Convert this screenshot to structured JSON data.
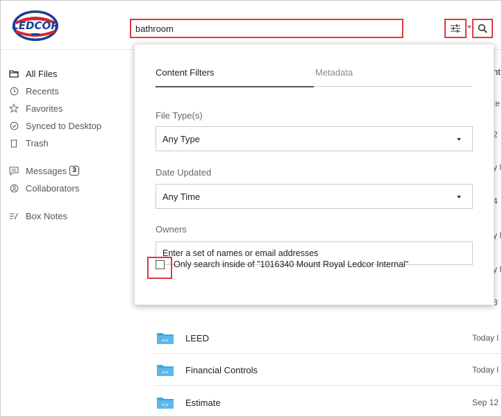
{
  "search": {
    "query": "bathroom"
  },
  "sidebar": {
    "items": [
      {
        "label": "All Files",
        "icon": "folder-icon"
      },
      {
        "label": "Recents",
        "icon": "clock-icon"
      },
      {
        "label": "Favorites",
        "icon": "star-icon"
      },
      {
        "label": "Synced to Desktop",
        "icon": "check-circle-icon"
      },
      {
        "label": "Trash",
        "icon": "trash-icon"
      },
      {
        "label": "Messages",
        "icon": "message-icon",
        "badge": "3"
      },
      {
        "label": "Collaborators",
        "icon": "collaborators-icon"
      },
      {
        "label": "Box Notes",
        "icon": "notes-icon"
      }
    ]
  },
  "filter_panel": {
    "tabs": [
      {
        "label": "Content Filters",
        "active": true
      },
      {
        "label": "Metadata",
        "active": false
      }
    ],
    "file_types": {
      "label": "File Type(s)",
      "value": "Any Type"
    },
    "date_updated": {
      "label": "Date Updated",
      "value": "Any Time"
    },
    "owners": {
      "label": "Owners",
      "placeholder": "Enter a set of names or email addresses"
    },
    "scope_checkbox": {
      "label": "Only search inside of \"1016340 Mount Royal Ledcor Internal\"",
      "checked": false
    }
  },
  "background_column": {
    "header": "nt",
    "cells": [
      "te",
      "2",
      "y l",
      "4",
      "y l",
      "y l",
      "3"
    ]
  },
  "files": [
    {
      "name": "LEED",
      "updated": "Today l"
    },
    {
      "name": "Financial Controls",
      "updated": "Today l"
    },
    {
      "name": "Estimate",
      "updated": "Sep 12"
    }
  ],
  "colors": {
    "highlight": "#e0383e",
    "folder": "#3aa7e0",
    "brand_blue": "#1c3f94",
    "brand_red": "#d8262e"
  }
}
